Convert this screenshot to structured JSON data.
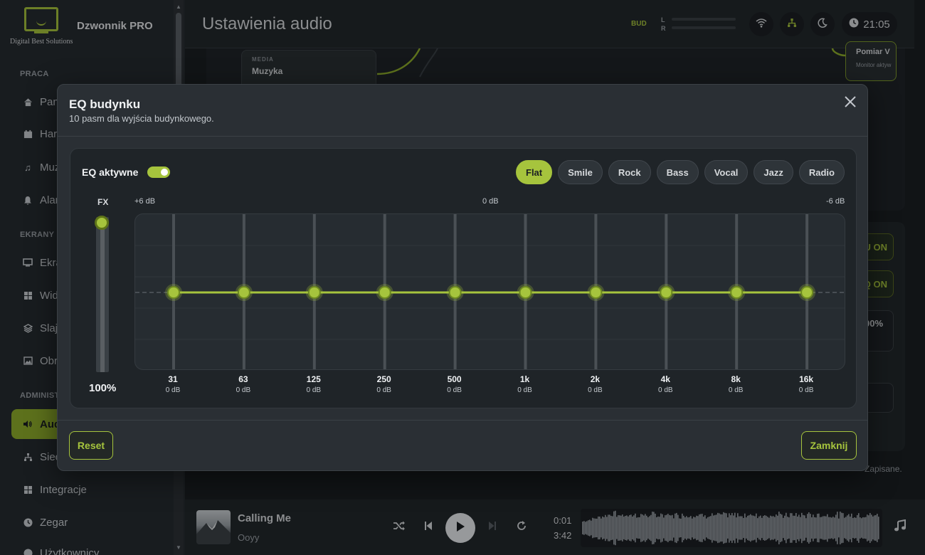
{
  "app": {
    "logo_text": "Digital Best Solutions",
    "name": "Dzwonnik PRO"
  },
  "sidebar": {
    "sections": [
      {
        "label": "PRACA"
      },
      {
        "label": "EKRANY"
      },
      {
        "label": "ADMINIST"
      }
    ],
    "items": [
      {
        "label": "Pan",
        "icon": "home-icon"
      },
      {
        "label": "Har",
        "icon": "calendar-icon"
      },
      {
        "label": "Muz",
        "icon": "music-icon"
      },
      {
        "label": "Alar",
        "icon": "bell-icon"
      },
      {
        "label": "Ekra",
        "icon": "monitor-icon"
      },
      {
        "label": "Wid",
        "icon": "widgets-icon"
      },
      {
        "label": "Slaj",
        "icon": "layers-icon"
      },
      {
        "label": "Obr",
        "icon": "image-icon"
      },
      {
        "label": "Aud",
        "icon": "speaker-icon",
        "active": true
      },
      {
        "label": "Siec",
        "icon": "network-icon"
      },
      {
        "label": "Integracje",
        "icon": "widgets-icon"
      },
      {
        "label": "Zegar",
        "icon": "clock-icon"
      },
      {
        "label": "Użytkownicy",
        "icon": "user-icon"
      }
    ]
  },
  "header": {
    "title": "Ustawienia audio",
    "bud": "BUD",
    "channel_l": "L",
    "channel_r": "R",
    "time": "21:05"
  },
  "background": {
    "media_kicker": "MEDIA",
    "media_title": "Muzyka",
    "pomiar_title": "Pomiar V",
    "pomiar_sub": "Monitor aktyw",
    "btn1": "U ON",
    "btn2": "Q ON",
    "field_value": "00%",
    "saved_note": "Zapisane."
  },
  "player": {
    "title": "Calling Me",
    "artist": "Ooyy",
    "elapsed": "0:01",
    "duration": "3:42"
  },
  "modal": {
    "title": "EQ budynku",
    "subtitle": "10 pasm dla wyjścia budynkowego.",
    "eq_active_label": "EQ aktywne",
    "eq_active": true,
    "presets": [
      "Flat",
      "Smile",
      "Rock",
      "Bass",
      "Vocal",
      "Jazz",
      "Radio"
    ],
    "active_preset": "Flat",
    "fx_label": "FX",
    "fx_value": "100%",
    "fx_level": 1.0,
    "db_max": "+6 dB",
    "db_mid": "0 dB",
    "db_min": "-6 dB",
    "bands": [
      {
        "freq": "31",
        "gain_label": "0 dB",
        "gain": 0
      },
      {
        "freq": "63",
        "gain_label": "0 dB",
        "gain": 0
      },
      {
        "freq": "125",
        "gain_label": "0 dB",
        "gain": 0
      },
      {
        "freq": "250",
        "gain_label": "0 dB",
        "gain": 0
      },
      {
        "freq": "500",
        "gain_label": "0 dB",
        "gain": 0
      },
      {
        "freq": "1k",
        "gain_label": "0 dB",
        "gain": 0
      },
      {
        "freq": "2k",
        "gain_label": "0 dB",
        "gain": 0
      },
      {
        "freq": "4k",
        "gain_label": "0 dB",
        "gain": 0
      },
      {
        "freq": "8k",
        "gain_label": "0 dB",
        "gain": 0
      },
      {
        "freq": "16k",
        "gain_label": "0 dB",
        "gain": 0
      }
    ],
    "reset_label": "Reset",
    "close_label": "Zamknij"
  },
  "colors": {
    "accent": "#a6c43d",
    "active_nav": "#8fae2c",
    "panel": "#1f2428"
  }
}
